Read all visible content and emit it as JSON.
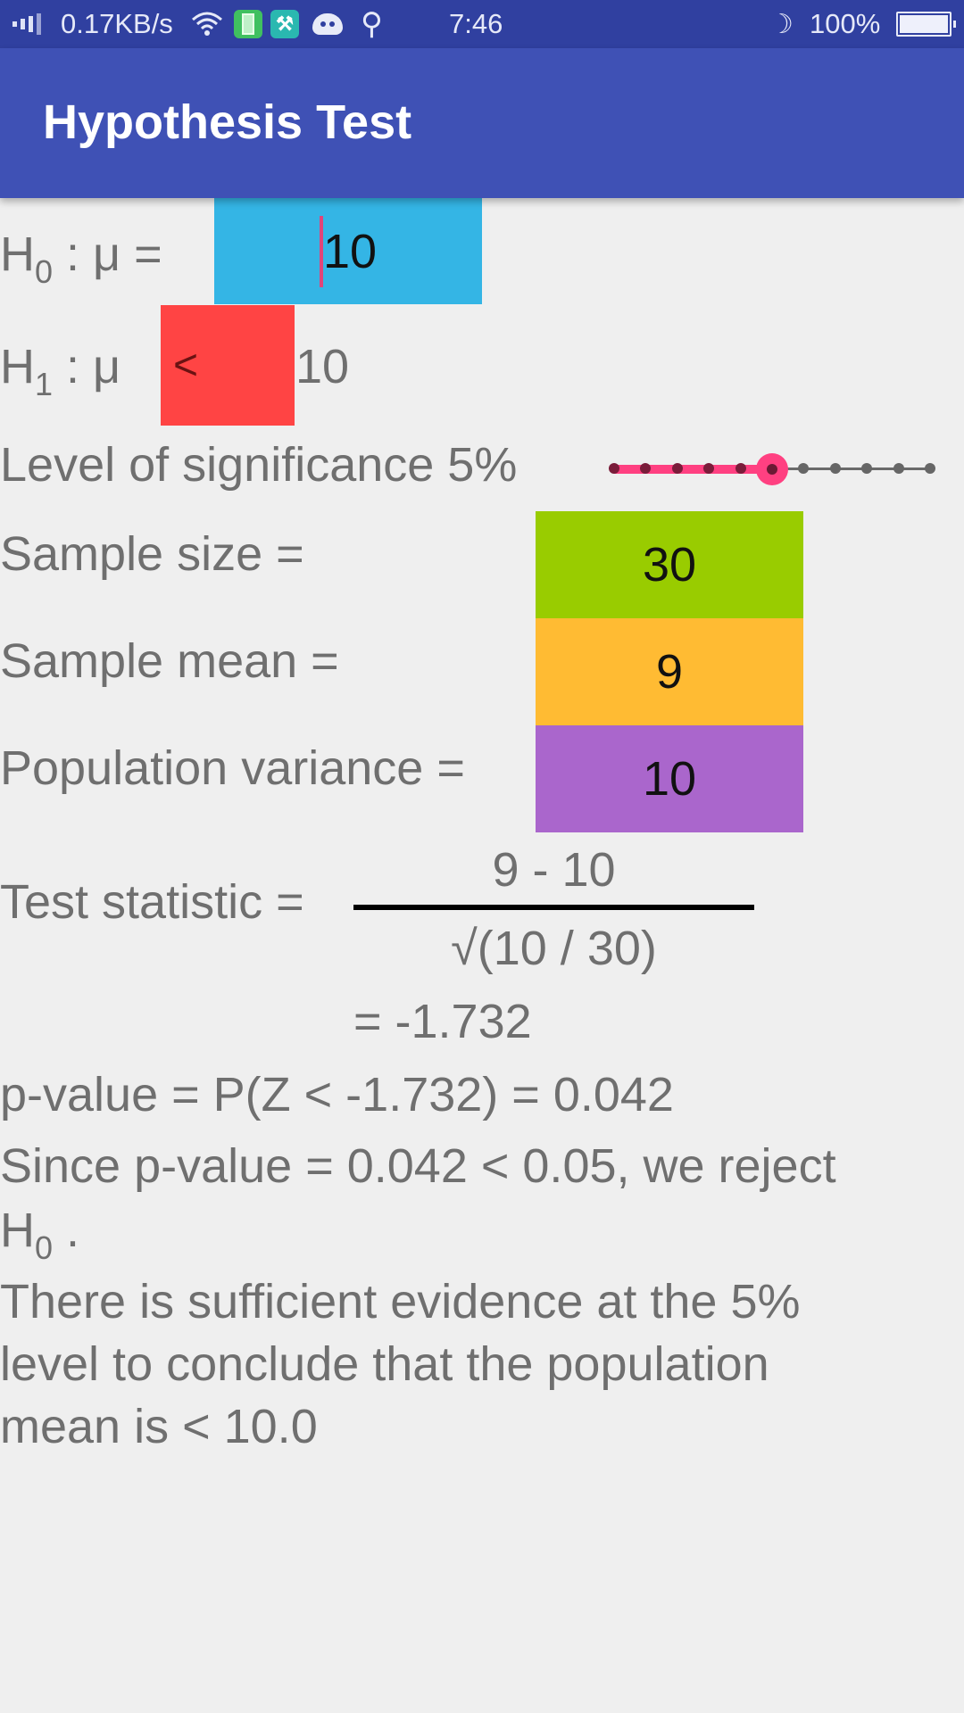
{
  "status_bar": {
    "net_speed": "0.17KB/s",
    "time": "7:46",
    "battery_percent": "100%",
    "icons": [
      "signal-icon",
      "wifi-icon",
      "battery-app-icon",
      "tools-icon",
      "android-icon",
      "usb-icon",
      "moon-icon",
      "battery-icon"
    ]
  },
  "app_bar": {
    "title": "Hypothesis Test"
  },
  "colors": {
    "app_bar": "#3f51b5",
    "status_bar": "#3040a0",
    "h0_field": "#34b5e5",
    "h1_operator": "#ff4444",
    "sample_size_field": "#99cc00",
    "sample_mean_field": "#ffbb33",
    "variance_field": "#aa66cc",
    "accent": "#ff4081"
  },
  "form": {
    "h0_label": "H",
    "h0_sub": "0",
    "h0_rest": " : μ =",
    "h0_value": "10",
    "h1_label": "H",
    "h1_sub": "1",
    "h1_rest": " : μ",
    "h1_operator": "<",
    "h1_value": "10",
    "significance_label": "Level of significance 5%",
    "significance_slider": {
      "min": 0,
      "max": 10,
      "value": 5,
      "ticks": 11
    },
    "sample_size_label": "Sample size =",
    "sample_size_value": "30",
    "sample_mean_label": "Sample mean =",
    "sample_mean_value": "9",
    "variance_label": "Population variance =",
    "variance_value": "10"
  },
  "result": {
    "test_stat_label": "Test statistic =",
    "numerator": "9 - 10",
    "denominator": "√(10 / 30)",
    "test_stat_value": "= -1.732",
    "p_value_line": "p-value = P(Z < -1.732) = 0.042",
    "decision_line": "Since p-value = 0.042 < 0.05, we reject",
    "decision_h": "H",
    "decision_sub": "0",
    "decision_end": " .",
    "conclusion_1": "There is sufficient evidence at the 5%",
    "conclusion_2": "level to conclude that the population",
    "conclusion_3": "mean is < 10.0"
  }
}
